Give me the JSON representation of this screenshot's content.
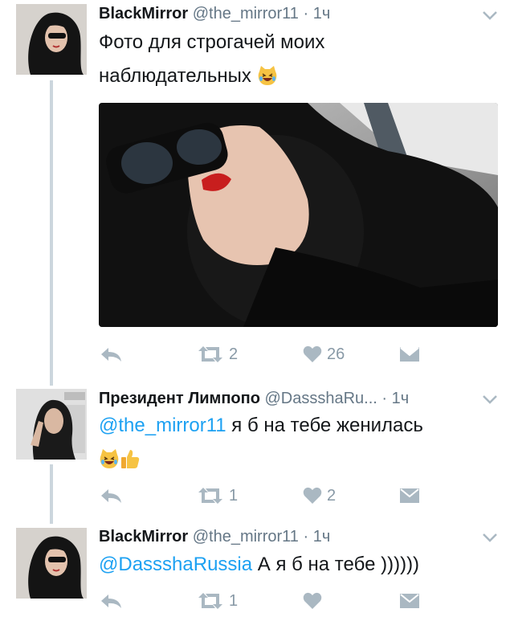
{
  "colors": {
    "link": "#1da1f2",
    "secondary": "#657786",
    "action": "#8899a6",
    "thread_line": "#ccd6dd"
  },
  "tweets": [
    {
      "name": "BlackMirror",
      "handle": "@the_mirror11",
      "separator": "·",
      "time": "1ч",
      "text_line1": "Фото для строгачей моих",
      "text_line2": "наблюдательных",
      "emoji": "laughing-cat-emoji",
      "media": "photo-woman-sunglasses-in-car",
      "retweets": "2",
      "likes": "26"
    },
    {
      "name": "Президент Лимпопо",
      "handle": "@DassshaRu...",
      "separator": "·",
      "time": "1ч",
      "mention": "@the_mirror11",
      "text": " я б на тебе женилась",
      "emoji": [
        "laughing-cat-emoji",
        "thumbs-up-emoji"
      ],
      "retweets": "1",
      "likes": "2"
    },
    {
      "name": "BlackMirror",
      "handle": "@the_mirror11",
      "separator": "·",
      "time": "1ч",
      "mention": "@DassshaRussia",
      "text": " А я б на тебе ))))))",
      "retweets": "1",
      "likes": ""
    }
  ]
}
